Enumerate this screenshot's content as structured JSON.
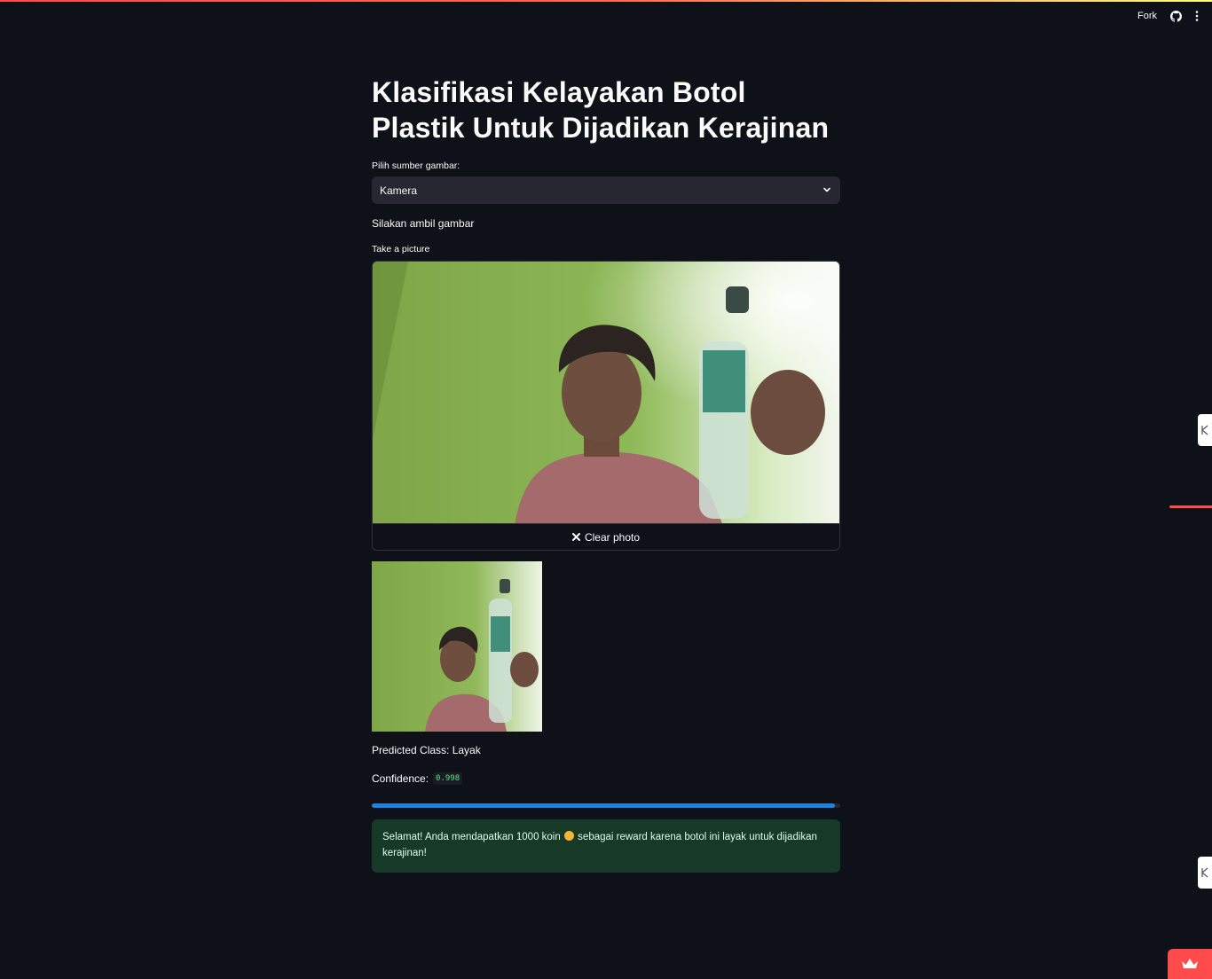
{
  "header": {
    "fork_label": "Fork",
    "icons": [
      "github-icon",
      "more-vertical-icon"
    ]
  },
  "main": {
    "title": "Klasifikasi Kelayakan Botol Plastik Untuk Dijadikan Kerajinan",
    "source_select": {
      "label": "Pilih sumber gambar:",
      "value": "Kamera"
    },
    "instruction": "Silakan ambil gambar",
    "camera": {
      "label": "Take a picture",
      "clear_label": "Clear photo"
    },
    "prediction": {
      "class_text": "Predicted Class: Layak",
      "confidence_label": "Confidence:",
      "confidence_value": "0.998",
      "progress_fraction": 0.988
    },
    "success_message": {
      "before_coin": "Selamat! Anda mendapatkan 1000 koin",
      "after_coin": "sebagai reward karena botol ini layak untuk dijadikan kerajinan!"
    }
  },
  "colors": {
    "background": "#0e1117",
    "accent": "#ff4b4b",
    "progress": "#1c83e1",
    "success_bg": "#173928"
  }
}
